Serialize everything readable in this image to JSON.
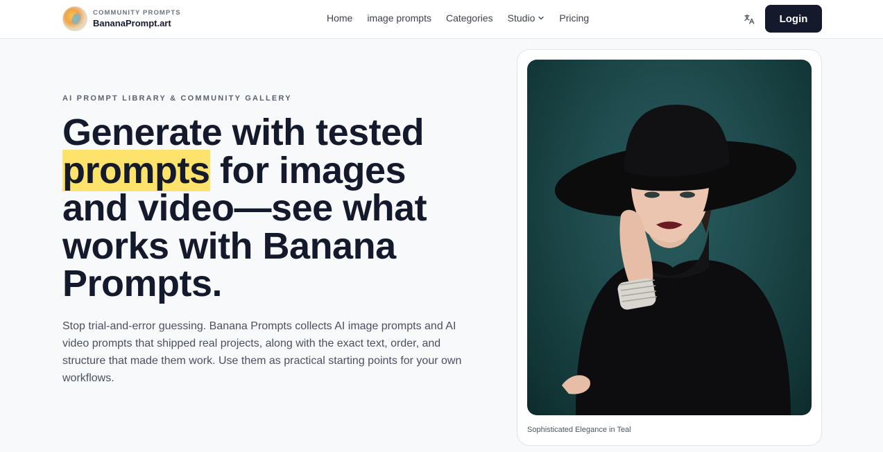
{
  "header": {
    "brand_tagline": "COMMUNITY PROMPTS",
    "brand_name": "BananaPrompt.art",
    "nav": [
      {
        "label": "Home"
      },
      {
        "label": "image prompts"
      },
      {
        "label": "Categories"
      },
      {
        "label": "Studio"
      },
      {
        "label": "Pricing"
      }
    ],
    "translate_icon": "translate-icon",
    "login_label": "Login"
  },
  "hero": {
    "eyebrow": "AI PROMPT LIBRARY & COMMUNITY GALLERY",
    "headline_part1": "Generate with tested",
    "headline_highlight": "prompts",
    "headline_part2": " for images and video—see what works with Banana Prompts.",
    "description": "Stop trial-and-error guessing. Banana Prompts collects AI image prompts and AI video prompts that shipped real projects, along with the exact text, order, and structure that made them work. Use them as practical starting points for your own workflows."
  },
  "showcase": {
    "caption": "Sophisticated Elegance in Teal"
  },
  "colors": {
    "accent_highlight": "#fde26b",
    "button_dark": "#141a2c",
    "photo_background": "#1e4a4c"
  }
}
